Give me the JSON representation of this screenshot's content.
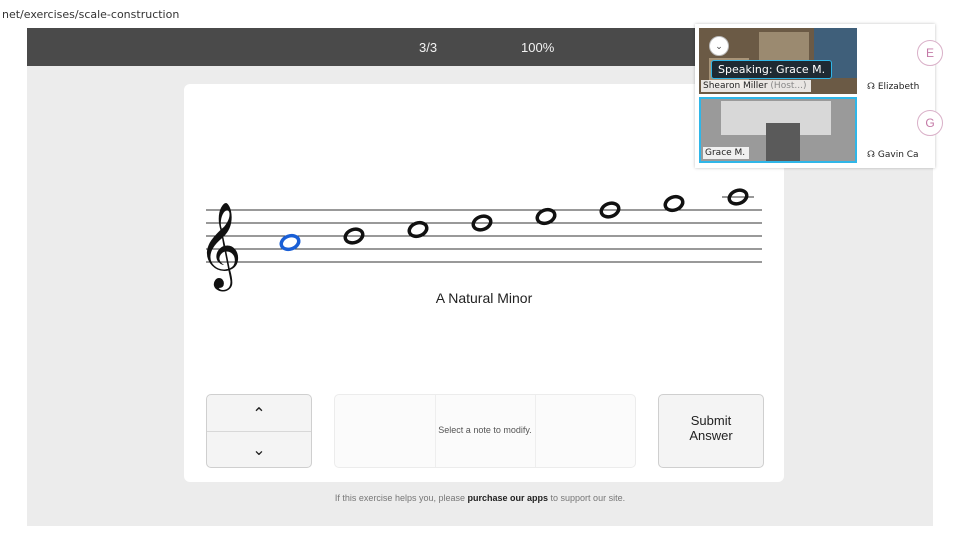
{
  "browser": {
    "url": "net/exercises/scale-construction"
  },
  "topbar": {
    "progress": "3/3",
    "percent": "100%"
  },
  "exercise": {
    "scale_name": "A Natural Minor",
    "clef": "𝄞",
    "notes": [
      "A4",
      "B4",
      "C5",
      "D5",
      "E5",
      "F5",
      "G5",
      "A5"
    ],
    "selected_note_index": 0,
    "note_color": "#111111",
    "selected_color": "#1a5fd6"
  },
  "controls": {
    "up_icon": "chevron-up-icon",
    "down_icon": "chevron-down-icon",
    "up_glyph": "⌃",
    "down_glyph": "⌄",
    "modify_hint": "Select a note to modify.",
    "submit_label": "Submit\nAnswer"
  },
  "footer": {
    "prefix": "If this exercise helps you, please ",
    "link": "purchase our apps",
    "suffix": " to support our site."
  },
  "video_call": {
    "speaking": "Speaking: Grace M.",
    "tiles": [
      {
        "name": "Shearon Miller",
        "role": "(Host...)"
      },
      {
        "name": "Grace M.",
        "role": ""
      }
    ],
    "side_participants": [
      {
        "name": "Elizabeth",
        "initial": "E"
      },
      {
        "name": "Gavin Ca",
        "initial": "G"
      }
    ],
    "accent": "#2fb6e8"
  }
}
